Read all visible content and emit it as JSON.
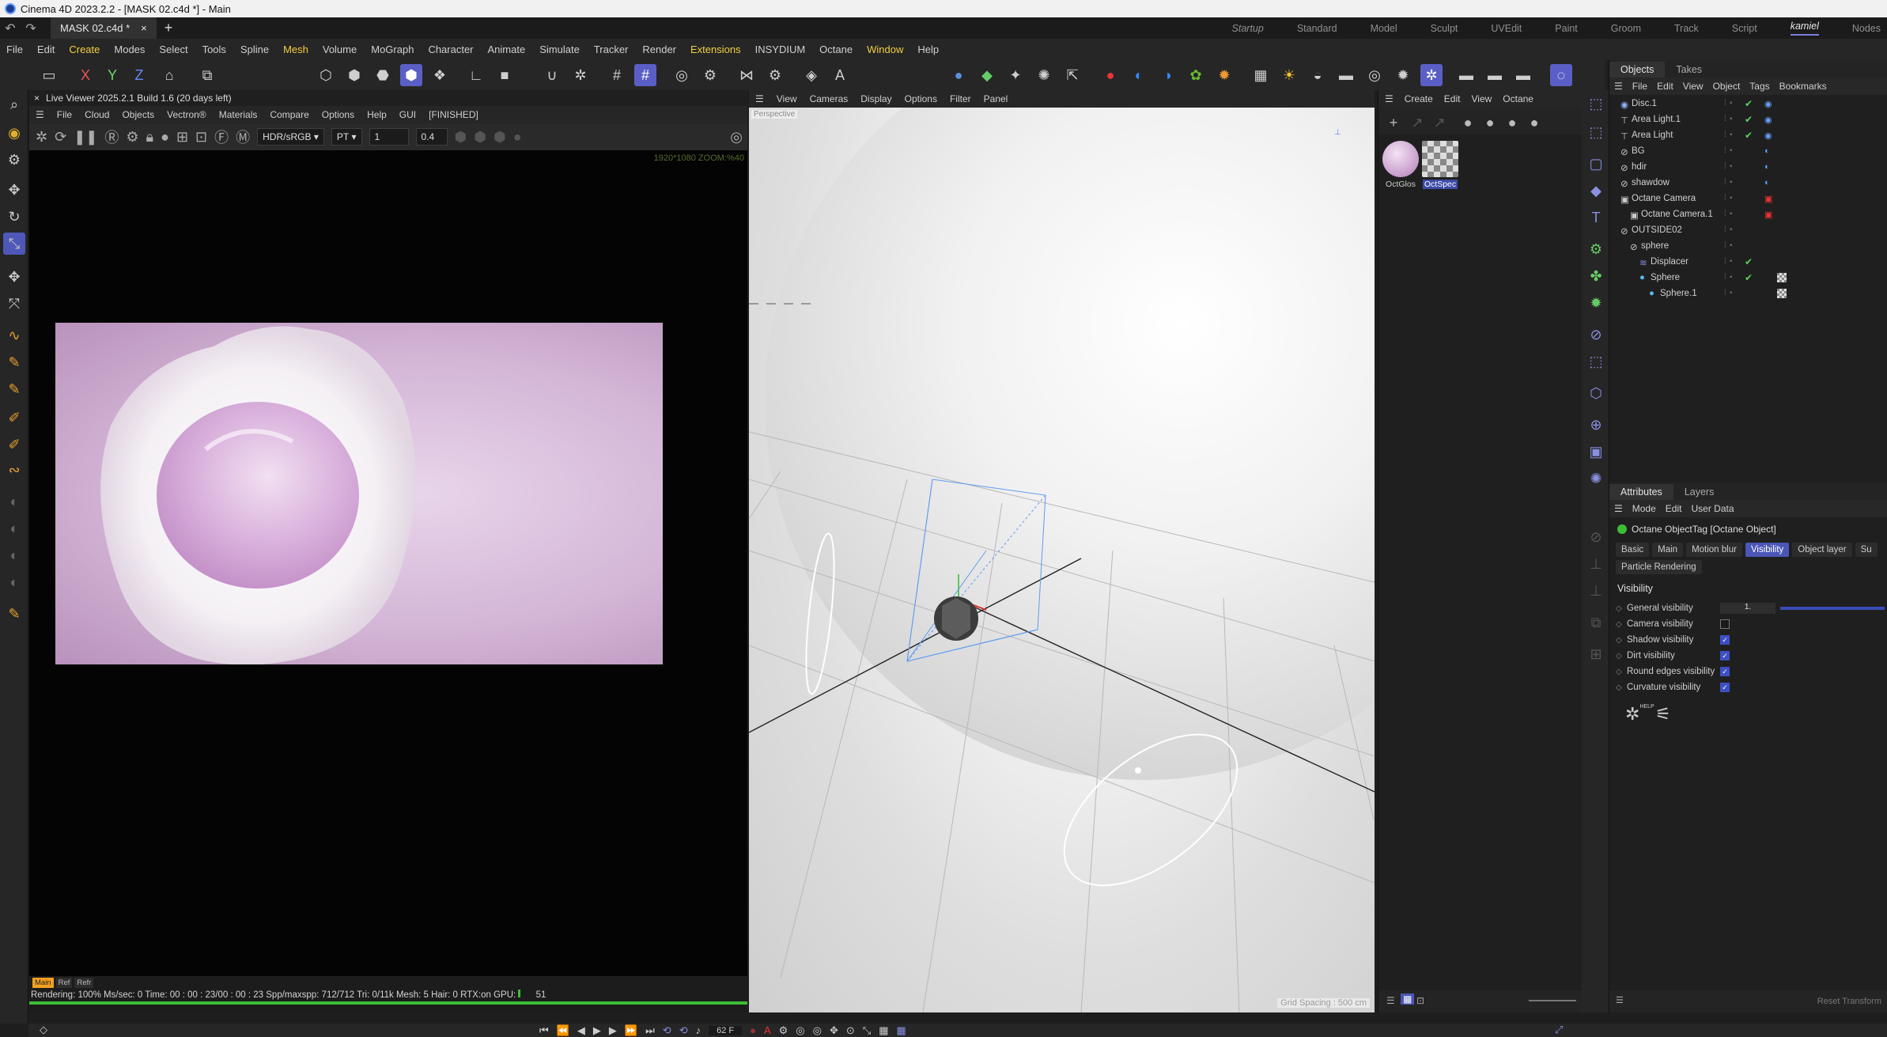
{
  "window": {
    "title": "Cinema 4D 2023.2.2 - [MASK 02.c4d *] - Main"
  },
  "doc_tab": {
    "label": "MASK 02.c4d *",
    "close": "×",
    "new_tab": "+"
  },
  "layouts": [
    {
      "label": "Startup",
      "style": "it"
    },
    {
      "label": "Standard",
      "style": ""
    },
    {
      "label": "Model",
      "style": ""
    },
    {
      "label": "Sculpt",
      "style": ""
    },
    {
      "label": "UVEdit",
      "style": ""
    },
    {
      "label": "Paint",
      "style": ""
    },
    {
      "label": "Groom",
      "style": ""
    },
    {
      "label": "Track",
      "style": ""
    },
    {
      "label": "Script",
      "style": ""
    },
    {
      "label": "kamiel",
      "style": "active"
    },
    {
      "label": "Nodes",
      "style": ""
    }
  ],
  "menu": [
    "File",
    "Edit",
    "Create",
    "Modes",
    "Select",
    "Tools",
    "Spline",
    "Mesh",
    "Volume",
    "MoGraph",
    "Character",
    "Animate",
    "Simulate",
    "Tracker",
    "Render",
    "Extensions",
    "INSYDIUM",
    "Octane",
    "Window",
    "Help"
  ],
  "menu_highlight": [
    "Create",
    "Mesh",
    "Extensions",
    "Window"
  ],
  "axis": {
    "x": "X",
    "y": "Y",
    "z": "Z"
  },
  "live_viewer": {
    "header": "Live Viewer 2025.2.1 Build 1.6 (20 days left)",
    "close": "×",
    "menu": [
      "File",
      "Cloud",
      "Objects",
      "Vectron®",
      "Materials",
      "Compare",
      "Options",
      "Help",
      "GUI",
      "[FINISHED]"
    ],
    "colorspace": "HDR/sRGB",
    "kernel": "PT",
    "value1": "1",
    "value2": "0.4",
    "resolution": "1920*1080  ZOOM:%40",
    "chips": [
      "Main",
      "Ref",
      "Refr"
    ],
    "status": "Rendering: 100% Ms/sec: 0   Time: 00 : 00 : 23/00 : 00 : 23    Spp/maxspp: 712/712   Tri: 0/11k    Mesh: 5  Hair: 0   RTX:on      GPU:",
    "gpu": "51",
    "progress": 1.0
  },
  "viewport": {
    "menu": [
      "View",
      "Cameras",
      "Display",
      "Options",
      "Filter",
      "Panel"
    ],
    "label": "Perspective",
    "grid_spacing": "Grid Spacing : 500 cm"
  },
  "materials": {
    "menu": [
      "Create",
      "Edit",
      "View",
      "Octane"
    ],
    "items": [
      {
        "name": "OctGlos",
        "selected": false
      },
      {
        "name": "OctSpec",
        "selected": true
      }
    ]
  },
  "objects_panel": {
    "tabs": [
      "Objects",
      "Takes"
    ],
    "menu": [
      "File",
      "Edit",
      "View",
      "Object",
      "Tags",
      "Bookmarks"
    ],
    "rows": [
      {
        "name": "Disc.1",
        "indent": 0,
        "icon": "disc-icon",
        "check": true
      },
      {
        "name": "Area Light.1",
        "indent": 0,
        "icon": "light-icon",
        "check": true
      },
      {
        "name": "Area Light",
        "indent": 0,
        "icon": "light-icon",
        "check": true
      },
      {
        "name": "BG",
        "indent": 0,
        "icon": "null-icon",
        "check": false
      },
      {
        "name": "hdir",
        "indent": 0,
        "icon": "null-icon",
        "check": false
      },
      {
        "name": "shawdow",
        "indent": 0,
        "icon": "null-icon",
        "check": false
      },
      {
        "name": "Octane Camera",
        "indent": 0,
        "icon": "camera-icon",
        "check": false
      },
      {
        "name": "Octane Camera.1",
        "indent": 1,
        "icon": "camera-icon",
        "check": false
      },
      {
        "name": "OUTSIDE02",
        "indent": 0,
        "icon": "null-icon",
        "check": false
      },
      {
        "name": "sphere",
        "indent": 1,
        "icon": "null-icon",
        "check": false
      },
      {
        "name": "Displacer",
        "indent": 2,
        "icon": "deformer-icon",
        "check": true
      },
      {
        "name": "Sphere",
        "indent": 2,
        "icon": "sphere-icon",
        "check": true
      },
      {
        "name": "Sphere.1",
        "indent": 3,
        "icon": "sphere-icon",
        "check": false
      }
    ]
  },
  "attributes": {
    "tabs": [
      "Attributes",
      "Layers"
    ],
    "menu": [
      "Mode",
      "Edit",
      "User Data"
    ],
    "title": "Octane ObjectTag [Octane Object]",
    "subtabs": [
      "Basic",
      "Main",
      "Motion blur",
      "Visibility",
      "Object layer",
      "Su",
      "Particle Rendering"
    ],
    "active_subtab": "Visibility",
    "section": "Visibility",
    "general_visibility": {
      "label": "General visibility",
      "value": "1."
    },
    "checks": [
      {
        "label": "Camera visibility",
        "checked": false
      },
      {
        "label": "Shadow visibility",
        "checked": true
      },
      {
        "label": "Dirt visibility",
        "checked": true
      },
      {
        "label": "Round edges visibility",
        "checked": true
      },
      {
        "label": "Curvature visibility",
        "checked": true
      }
    ],
    "help": "HELP",
    "reset": "Reset Transform"
  },
  "timeline": {
    "frame": "62 F"
  },
  "colors": {
    "accent": "#5a5fc6",
    "highlight_menu": "#f4cf41",
    "check_green": "#5bd15b",
    "progress_green": "#3cbc35"
  }
}
